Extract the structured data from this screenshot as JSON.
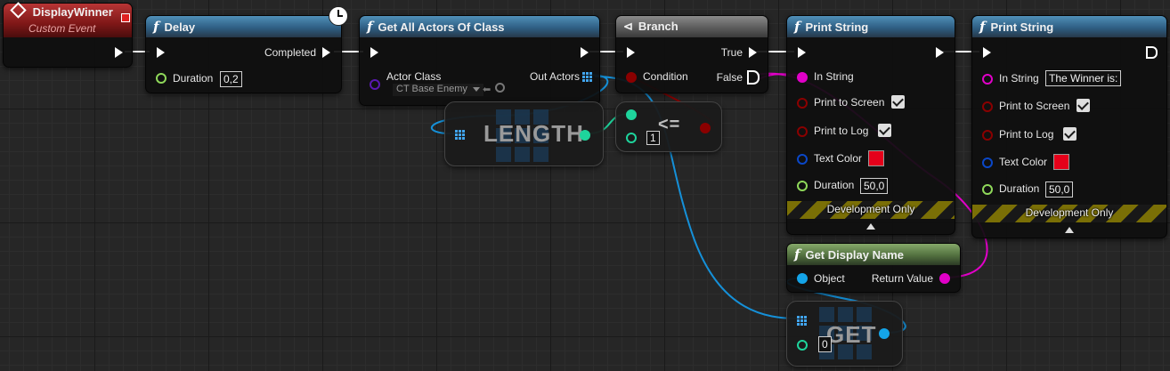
{
  "colors": {
    "exec": "#ffffff",
    "float": "#8fd85a",
    "class": "#5a19b0",
    "object": "#14a4e8",
    "string": "#e100c8",
    "bool": "#8a0000",
    "int": "#1ed49c",
    "linear_color": "#0a47c8",
    "function_header": "#2f5f84"
  },
  "nodes": {
    "custom_event": {
      "title": "DisplayWinner",
      "subtitle": "Custom Event"
    },
    "delay": {
      "title": "Delay",
      "completed": "Completed",
      "duration_label": "Duration",
      "duration_value": "0,2",
      "clock_icon": "clock-icon"
    },
    "get_all_actors": {
      "title": "Get All Actors Of Class",
      "actor_class_label": "Actor Class",
      "actor_class_value": "CT Base Enemy",
      "out_actors": "Out Actors"
    },
    "length": {
      "title": "LENGTH"
    },
    "compare": {
      "op": "<=",
      "value": "1"
    },
    "branch": {
      "title": "Branch",
      "condition": "Condition",
      "true_label": "True",
      "false_label": "False"
    },
    "print_string_1": {
      "title": "Print String",
      "in_string": "In String",
      "print_to_screen": "Print to Screen",
      "print_to_log": "Print to Log",
      "text_color": "Text Color",
      "duration": "Duration",
      "duration_value": "50,0",
      "dev_only": "Development Only"
    },
    "print_string_2": {
      "title": "Print String",
      "in_string": "In String",
      "in_string_value": "The Winner is:",
      "print_to_screen": "Print to Screen",
      "print_to_log": "Print to Log",
      "text_color": "Text Color",
      "duration": "Duration",
      "duration_value": "50,0",
      "dev_only": "Development Only"
    },
    "get_display_name": {
      "title": "Get Display Name",
      "object": "Object",
      "return_value": "Return Value"
    },
    "get": {
      "title": "GET",
      "index": "0"
    }
  }
}
